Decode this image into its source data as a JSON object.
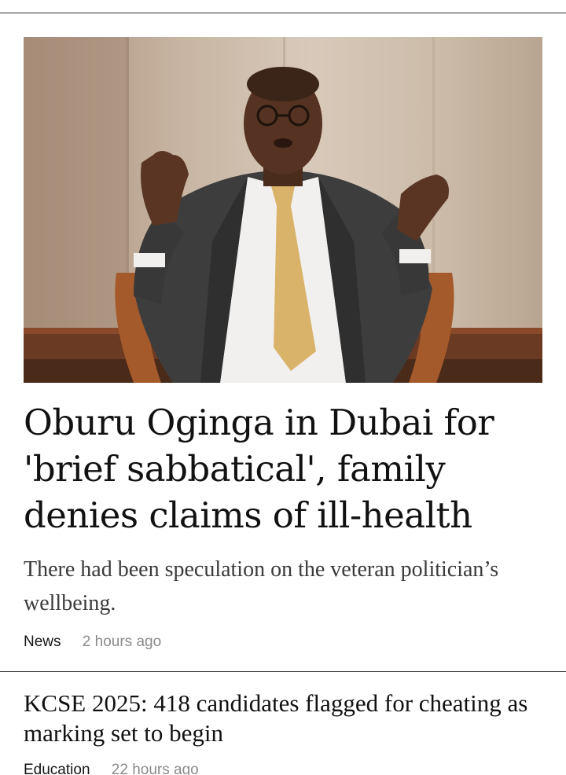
{
  "articles": [
    {
      "image_alt": "Oburu Oginga seated in a chair, gesturing while speaking",
      "title": "Oburu Oginga in Dubai for 'brief sabbatical', family denies claims of ill-health",
      "summary": "There had been speculation on the veteran politician’s wellbeing.",
      "category": "News",
      "time": "2 hours ago"
    },
    {
      "title": "KCSE 2025: 418 candidates flagged for cheating as marking set to begin",
      "category": "Education",
      "time": "22 hours ago"
    }
  ],
  "colors": {
    "text": "#111111",
    "summary": "#3a3a3a",
    "meta_time": "#8a8a8a",
    "rule": "#2a2a2a"
  }
}
